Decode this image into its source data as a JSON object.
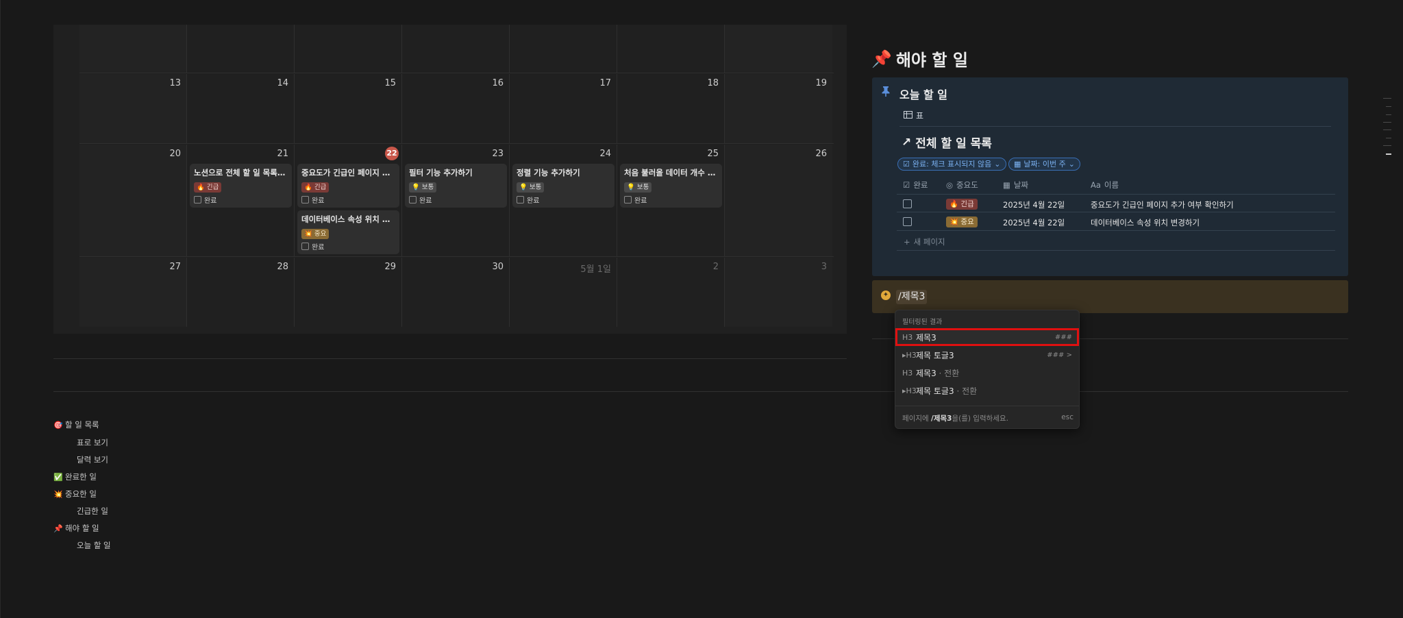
{
  "calendar": {
    "weeks": [
      {
        "days": [
          "",
          "",
          "",
          "",
          "",
          "",
          ""
        ]
      },
      {
        "days": [
          "13",
          "14",
          "15",
          "16",
          "17",
          "18",
          "19"
        ]
      },
      {
        "days": [
          "20",
          "21",
          "22",
          "23",
          "24",
          "25",
          "26"
        ]
      },
      {
        "days": [
          "27",
          "28",
          "29",
          "30",
          "5월 1일",
          "2",
          "3"
        ]
      }
    ],
    "cards": [
      {
        "title": "노션으로 전체 할 일 목록 만...",
        "tag": "🔥 긴급",
        "check": "완료"
      },
      {
        "title": "중요도가 긴급인 페이지 추...",
        "tag": "🔥 긴급",
        "check": "완료"
      },
      {
        "title": "데이터베이스 속성 위치 변...",
        "tag": "💥 중요",
        "check": "완료"
      },
      {
        "title": "필터 기능 추가하기",
        "tag": "💡 보통",
        "check": "완료"
      },
      {
        "title": "정렬 기능 추가하기",
        "tag": "💡 보통",
        "check": "완료"
      },
      {
        "title": "처음 불러올 데이터 개수 지...",
        "tag": "💡 보통",
        "check": "완료"
      }
    ]
  },
  "links": [
    {
      "emoji": "🎯",
      "label": "할 일 목록"
    },
    {
      "emoji": "",
      "label": "표로 보기"
    },
    {
      "emoji": "",
      "label": "달력 보기"
    },
    {
      "emoji": "✅",
      "label": "완료한 일"
    },
    {
      "emoji": "💥",
      "label": "중요한 일"
    },
    {
      "emoji": "",
      "label": "긴급한 일"
    },
    {
      "emoji": "📌",
      "label": "해야 할 일"
    },
    {
      "emoji": "",
      "label": "오늘 할 일"
    }
  ],
  "page": {
    "heading": "해야 할 일",
    "heading_icon": "📌",
    "today": {
      "title": "오늘 할 일",
      "view_label": "표",
      "db_title": "전체 할 일 목록",
      "filters": [
        "완료: 체크 표시되지 않음",
        "날짜: 이번 주"
      ],
      "columns": [
        "완료",
        "중요도",
        "날짜",
        "이름"
      ],
      "rows": [
        {
          "importance": "🔥 긴급",
          "date": "2025년 4월 22일",
          "name": "중요도가 긴급인 페이지 추가 여부 확인하기"
        },
        {
          "importance": "💥 중요",
          "date": "2025년 4월 22일",
          "name": "데이터베이스 속성 위치 변경하기"
        }
      ],
      "new_page": "새 페이지"
    },
    "command_text": "/제목3"
  },
  "popup": {
    "header": "필터링된 결과",
    "items": [
      {
        "icon": "H3",
        "label": "제목3",
        "suffix": "",
        "shortcut": "###"
      },
      {
        "icon": "▸H3",
        "label": "제목 토글3",
        "suffix": "",
        "shortcut": "### >"
      },
      {
        "icon": "H3",
        "label": "제목3",
        "suffix": "· 전환",
        "shortcut": ""
      },
      {
        "icon": "▸H3",
        "label": "제목 토글3",
        "suffix": "· 전환",
        "shortcut": ""
      }
    ],
    "footer_prefix": "페이지에",
    "footer_query": "/제목3",
    "footer_suffix": "을(를) 입력하세요.",
    "footer_esc": "esc"
  },
  "colors": {
    "background": "#191919",
    "today_badge": "#c9574a",
    "panel_blue": "#1f2a35",
    "filter_blue": "#7ab0f0",
    "selection_red": "#e01010"
  }
}
